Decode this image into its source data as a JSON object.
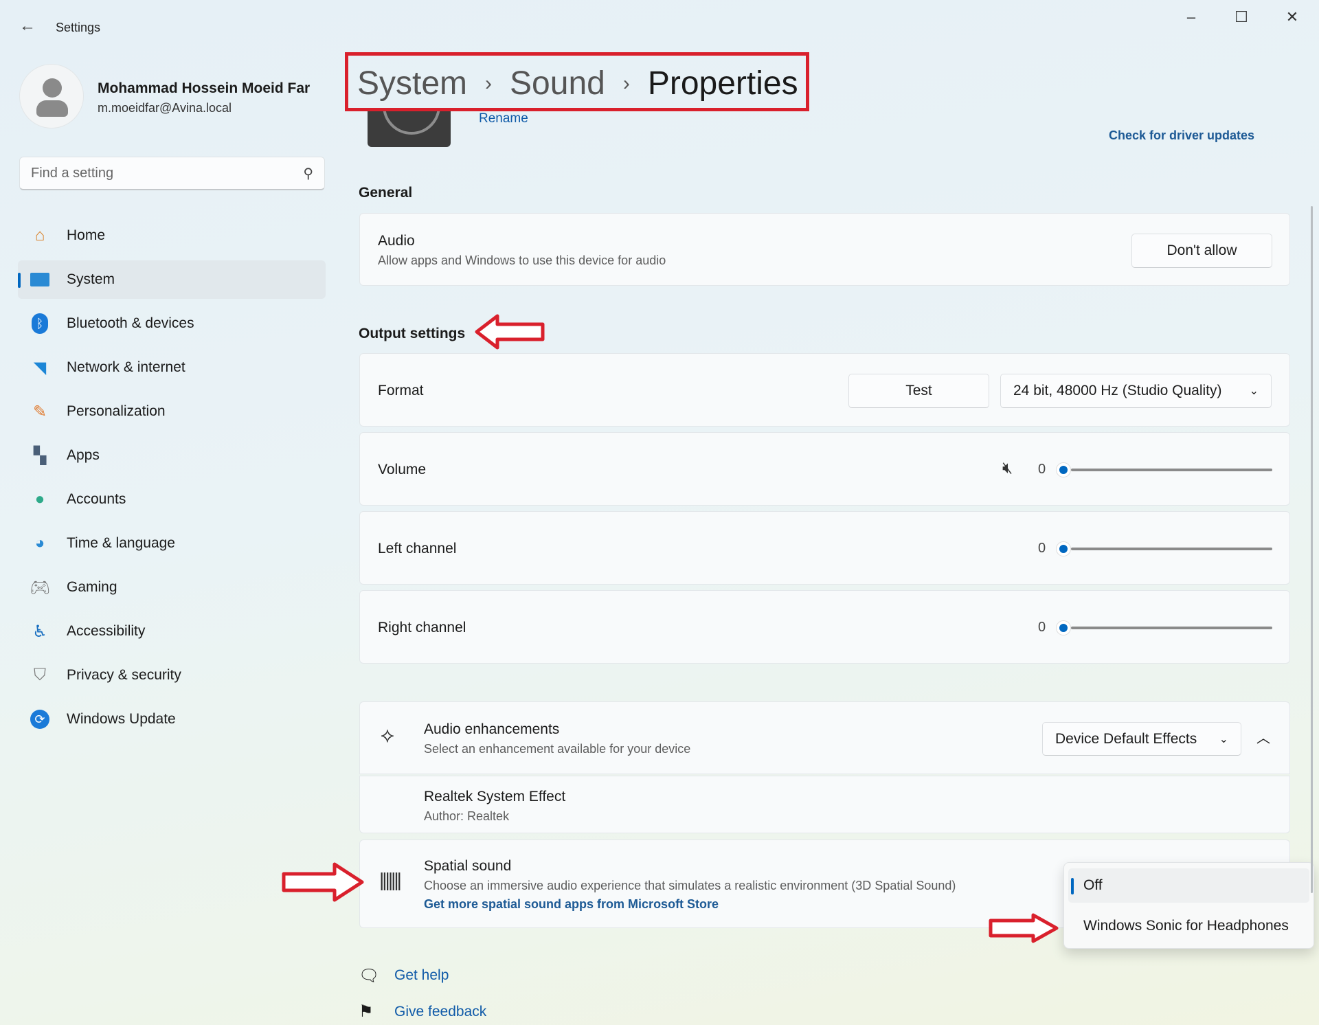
{
  "window": {
    "title": "Settings",
    "minimize": "–",
    "maximize": "☐",
    "close": "✕"
  },
  "user": {
    "name": "Mohammad Hossein Moeid Far",
    "email": "m.moeidfar@Avina.local"
  },
  "search": {
    "placeholder": "Find a setting"
  },
  "sidebar": {
    "items": [
      {
        "label": "Home",
        "icon": "home-icon"
      },
      {
        "label": "System",
        "icon": "system-icon",
        "selected": true
      },
      {
        "label": "Bluetooth & devices",
        "icon": "bluetooth-icon"
      },
      {
        "label": "Network & internet",
        "icon": "wifi-icon"
      },
      {
        "label": "Personalization",
        "icon": "brush-icon"
      },
      {
        "label": "Apps",
        "icon": "apps-icon"
      },
      {
        "label": "Accounts",
        "icon": "accounts-icon"
      },
      {
        "label": "Time & language",
        "icon": "globe-clock-icon"
      },
      {
        "label": "Gaming",
        "icon": "gamepad-icon"
      },
      {
        "label": "Accessibility",
        "icon": "accessibility-icon"
      },
      {
        "label": "Privacy & security",
        "icon": "shield-icon"
      },
      {
        "label": "Windows Update",
        "icon": "update-icon"
      }
    ]
  },
  "breadcrumb": [
    "System",
    "Sound",
    "Properties"
  ],
  "device": {
    "rename": "Rename",
    "driver_updates": "Check for driver updates"
  },
  "general": {
    "heading": "General",
    "audio_title": "Audio",
    "audio_desc": "Allow apps and Windows to use this device for audio",
    "audio_button": "Don't allow"
  },
  "output": {
    "heading": "Output settings",
    "format_label": "Format",
    "test_button": "Test",
    "format_value": "24 bit, 48000 Hz (Studio Quality)",
    "volume_label": "Volume",
    "volume_value": "0",
    "left_label": "Left channel",
    "left_value": "0",
    "right_label": "Right channel",
    "right_value": "0"
  },
  "enhancements": {
    "title": "Audio enhancements",
    "desc": "Select an enhancement available for your device",
    "value": "Device Default Effects",
    "effect_title": "Realtek System Effect",
    "effect_author": "Author: Realtek"
  },
  "spatial": {
    "title": "Spatial sound",
    "desc": "Choose an immersive audio experience that simulates a realistic environment (3D Spatial Sound)",
    "link": "Get more spatial sound apps from Microsoft Store",
    "options": [
      "Off",
      "Windows Sonic for Headphones"
    ],
    "selected": "Off"
  },
  "footer": {
    "help": "Get help",
    "feedback": "Give feedback"
  },
  "colors": {
    "accent": "#0067c0",
    "annotation": "#d9202c"
  }
}
